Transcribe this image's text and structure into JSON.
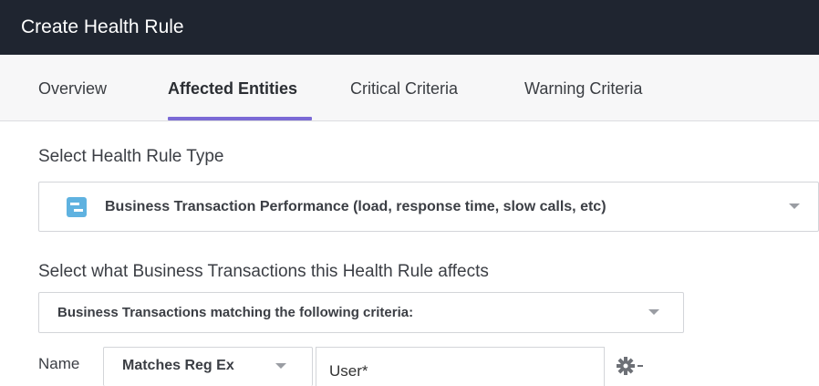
{
  "window": {
    "title": "Create Health Rule"
  },
  "tabs": [
    {
      "label": "Overview",
      "active": false
    },
    {
      "label": "Affected Entities",
      "active": true
    },
    {
      "label": "Critical Criteria",
      "active": false
    },
    {
      "label": "Warning Criteria",
      "active": false
    }
  ],
  "rule_type": {
    "label": "Select Health Rule Type",
    "selected": "Business Transaction Performance (load, response time, slow calls, etc)",
    "icon": "business-transaction-icon"
  },
  "affects": {
    "label": "Select what Business Transactions this Health Rule affects",
    "selected": "Business Transactions matching the following criteria:"
  },
  "criteria": {
    "field_label": "Name",
    "operator": "Matches Reg Ex",
    "value": "User*",
    "settings_icon": "gear-icon"
  },
  "colors": {
    "titlebar": "#1f2530",
    "tab_indicator": "#7b6ad6",
    "icon_blue": "#5fb2e0"
  }
}
